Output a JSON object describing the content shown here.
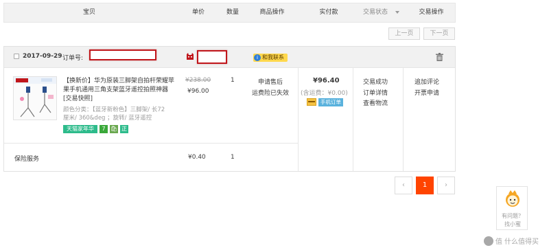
{
  "header": {
    "col_item": "宝贝",
    "col_price": "单价",
    "col_qty": "数量",
    "col_ops": "商品操作",
    "col_paid": "实付款",
    "col_status": "交易状态",
    "col_trade_ops": "交易操作"
  },
  "pager_top": {
    "prev": "上一页",
    "next": "下一页"
  },
  "order": {
    "date": "2017-09-29",
    "order_no_label": "订单号:",
    "contact_label": "和我联系",
    "item": {
      "title_pre": "【换新价】华为原装三脚架",
      "title_highlight": "自拍",
      "title_post": "杆荣耀苹果手机通用三角支架蓝牙遥控拍照神器[交易快照]",
      "title_lines": [
        "【换新价】华为原装三脚架自拍杆荣耀苹",
        "果手机通用三角支架蓝牙遥控拍照神器",
        "[交易快照]"
      ],
      "spec_lines": [
        "颜色分类：【蓝牙新粉色】三脚架/ 长72",
        "厘米/ 360&deg ；旋转/ 蓝牙遥控"
      ],
      "badges": [
        "天猫家年华",
        "7",
        "🛍",
        "正"
      ],
      "original_price": "¥238.00",
      "price": "¥96.00",
      "qty": "1",
      "ops": [
        "申请售后",
        "运费险已失效"
      ]
    },
    "paid": {
      "amount": "¥96.40",
      "shipping": "(含运费：¥0.00)",
      "mobile_badge": "手机订单"
    },
    "status": [
      "交易成功",
      "订单详情",
      "查看物流"
    ],
    "trade_ops": [
      "追加评论",
      "开票申请"
    ],
    "insurance": {
      "label": "保险服务",
      "price": "¥0.40",
      "qty": "1"
    }
  },
  "pager_bottom": {
    "prev": "‹",
    "current": "1",
    "next": "›"
  },
  "helper": {
    "line1": "有问题？",
    "line2": "找小蜜"
  },
  "watermark": "值 什么值得买",
  "colors": {
    "accent": "#f40",
    "red_box": "#c0161b",
    "badge_teal": "#2dbb8b",
    "contact_yellow": "#ffd84d"
  }
}
